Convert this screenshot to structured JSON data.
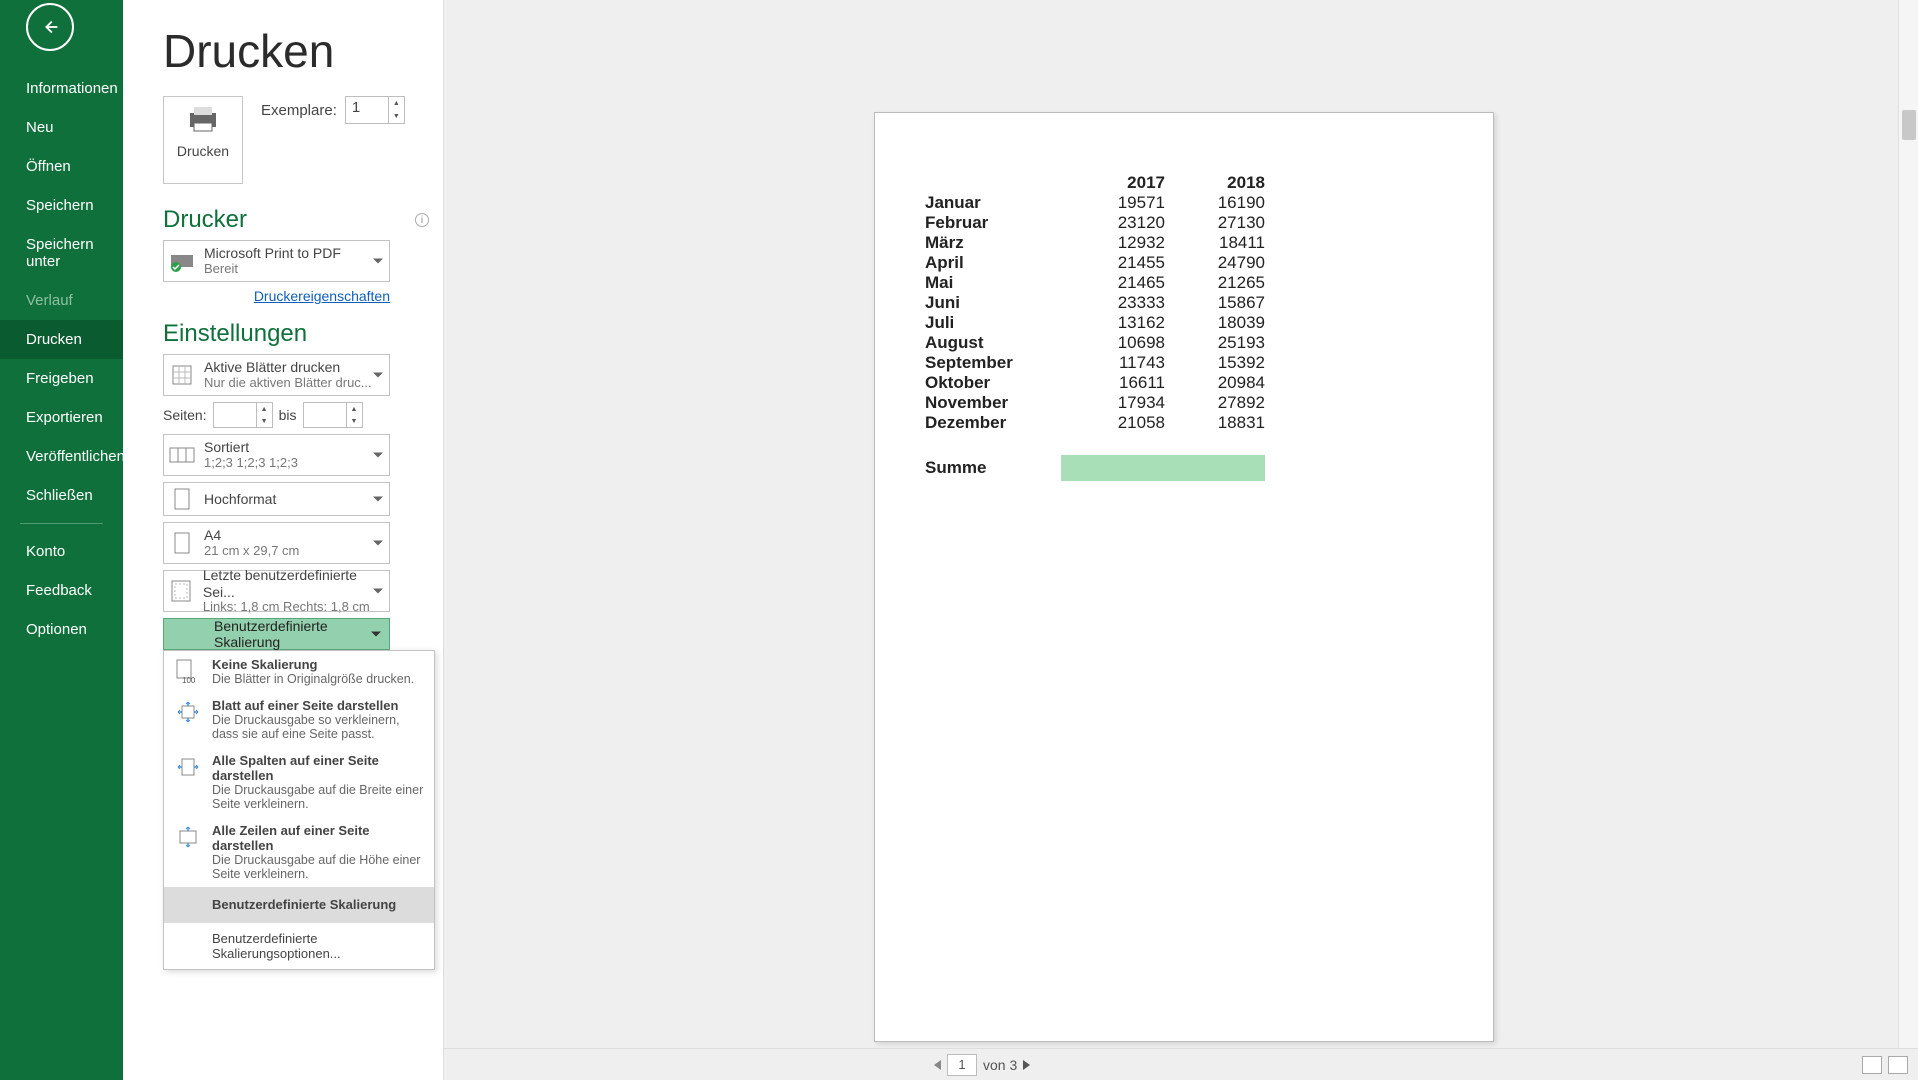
{
  "sidebar": {
    "items": [
      {
        "label": "Informationen"
      },
      {
        "label": "Neu"
      },
      {
        "label": "Öffnen"
      },
      {
        "label": "Speichern"
      },
      {
        "label": "Speichern unter"
      },
      {
        "label": "Verlauf"
      },
      {
        "label": "Drucken"
      },
      {
        "label": "Freigeben"
      },
      {
        "label": "Exportieren"
      },
      {
        "label": "Veröffentlichen"
      },
      {
        "label": "Schließen"
      }
    ],
    "lower": [
      {
        "label": "Konto"
      },
      {
        "label": "Feedback"
      },
      {
        "label": "Optionen"
      }
    ]
  },
  "header": {
    "title": "Drucken"
  },
  "print_button": "Drucken",
  "copies": {
    "label": "Exemplare:",
    "value": "1"
  },
  "printer": {
    "heading": "Drucker",
    "name": "Microsoft Print to PDF",
    "status": "Bereit",
    "properties": "Druckereigenschaften"
  },
  "settings": {
    "heading": "Einstellungen",
    "active_sheets": {
      "title": "Aktive Blätter drucken",
      "sub": "Nur die aktiven Blätter druc..."
    },
    "pages": {
      "label": "Seiten:",
      "to": "bis"
    },
    "collate": {
      "title": "Sortiert",
      "sub": "1;2;3    1;2;3    1;2;3"
    },
    "orientation": "Hochformat",
    "paper": {
      "title": "A4",
      "sub": "21 cm x 29,7 cm"
    },
    "margins": {
      "title": "Letzte benutzerdefinierte Sei...",
      "sub": "Links: 1,8 cm    Rechts: 1,8 cm"
    },
    "scaling": {
      "selected": "Benutzerdefinierte Skalierung",
      "options": [
        {
          "title": "Keine Skalierung",
          "sub": "Die Blätter in Originalgröße drucken."
        },
        {
          "title": "Blatt auf einer Seite darstellen",
          "sub": "Die Druckausgabe so verkleinern, dass sie auf eine Seite passt."
        },
        {
          "title": "Alle Spalten auf einer Seite darstellen",
          "sub": "Die Druckausgabe auf die Breite einer Seite verkleinern."
        },
        {
          "title": "Alle Zeilen auf einer Seite darstellen",
          "sub": "Die Druckausgabe auf die Höhe einer Seite verkleinern."
        },
        {
          "title": "Benutzerdefinierte Skalierung"
        }
      ],
      "footer": "Benutzerdefinierte Skalierungsoptionen..."
    }
  },
  "preview": {
    "years": [
      "2017",
      "2018"
    ],
    "rows": [
      {
        "m": "Januar",
        "a": "19571",
        "b": "16190"
      },
      {
        "m": "Februar",
        "a": "23120",
        "b": "27130"
      },
      {
        "m": "März",
        "a": "12932",
        "b": "18411"
      },
      {
        "m": "April",
        "a": "21455",
        "b": "24790"
      },
      {
        "m": "Mai",
        "a": "21465",
        "b": "21265"
      },
      {
        "m": "Juni",
        "a": "23333",
        "b": "15867"
      },
      {
        "m": "Juli",
        "a": "13162",
        "b": "18039"
      },
      {
        "m": "August",
        "a": "10698",
        "b": "25193"
      },
      {
        "m": "September",
        "a": "11743",
        "b": "15392"
      },
      {
        "m": "Oktober",
        "a": "16611",
        "b": "20984"
      },
      {
        "m": "November",
        "a": "17934",
        "b": "27892"
      },
      {
        "m": "Dezember",
        "a": "21058",
        "b": "18831"
      }
    ],
    "sum_label": "Summe"
  },
  "pager": {
    "current": "1",
    "of_label": "von 3"
  }
}
